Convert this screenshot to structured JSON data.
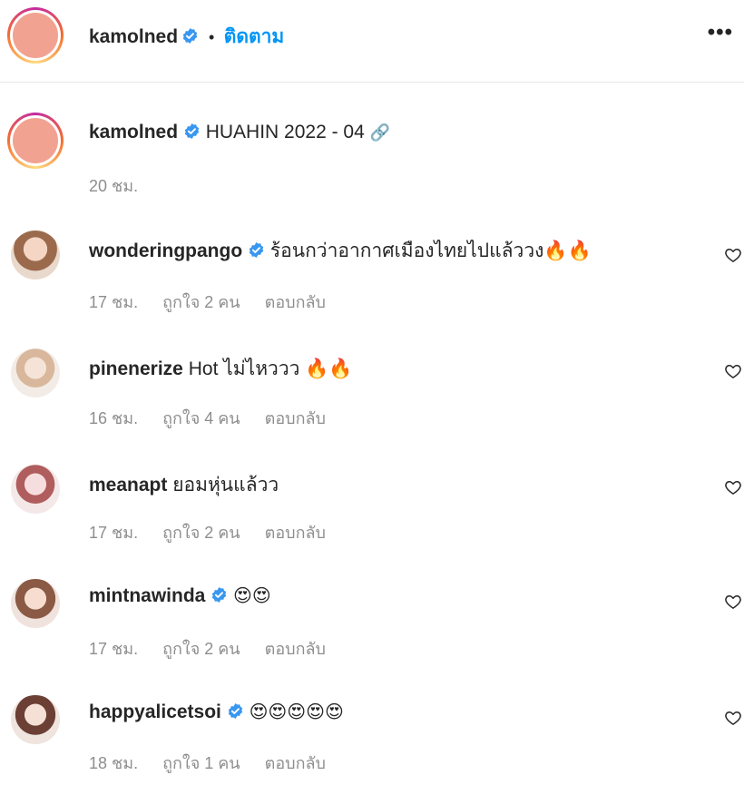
{
  "header": {
    "username": "kamolned",
    "separator": "•",
    "follow_label": "ติดตาม",
    "more_label": "•••"
  },
  "caption": {
    "username": "kamolned",
    "text": "HUAHIN 2022 - 04",
    "time": "20 ชม."
  },
  "comments": [
    {
      "username": "wonderingpango",
      "verified": true,
      "text": "ร้อนกว่าอากาศเมืองไทยไปแล้ววง🔥🔥",
      "time": "17 ชม.",
      "likes": "ถูกใจ 2 คน",
      "reply": "ตอบกลับ"
    },
    {
      "username": "pinenerize",
      "verified": false,
      "text": "Hot ไม่ไหววว 🔥🔥",
      "time": "16 ชม.",
      "likes": "ถูกใจ 4 คน",
      "reply": "ตอบกลับ"
    },
    {
      "username": "meanapt",
      "verified": false,
      "text": "ยอมหุ่นแล้วว",
      "time": "17 ชม.",
      "likes": "ถูกใจ 2 คน",
      "reply": "ตอบกลับ"
    },
    {
      "username": "mintnawinda",
      "verified": true,
      "text": "😍😍",
      "time": "17 ชม.",
      "likes": "ถูกใจ 2 คน",
      "reply": "ตอบกลับ"
    },
    {
      "username": "happyalicetsoi",
      "verified": true,
      "text": "😍😍😍😍😍",
      "time": "18 ชม.",
      "likes": "ถูกใจ 1 คน",
      "reply": "ตอบกลับ"
    }
  ],
  "colors": {
    "verified_badge": "#3897f0",
    "follow": "#0095f6",
    "muted": "#8e8e8e",
    "avatar_placeholder": "#f2a291"
  }
}
